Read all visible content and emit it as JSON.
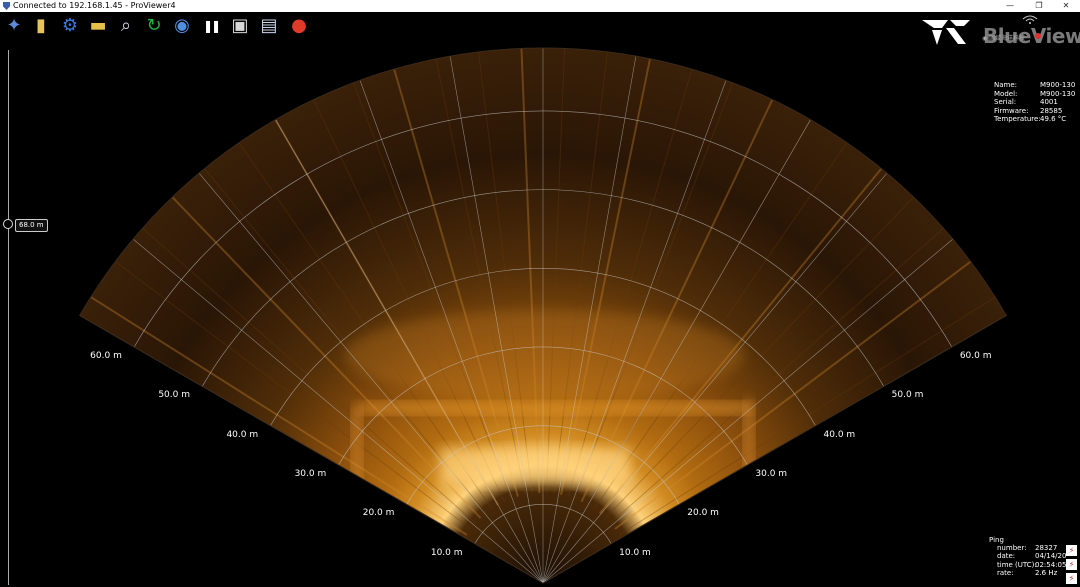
{
  "window": {
    "title": "Connected to 192.168.1.45 - ProViewer4",
    "minimize_glyph": "—",
    "restore_glyph": "❐",
    "close_glyph": "✕"
  },
  "toolbar": {
    "items": [
      {
        "name": "satellite-icon",
        "glyph": "✦",
        "color": "#5b8ad6"
      },
      {
        "name": "folder-icon",
        "glyph": "▮",
        "color": "#e8c25a"
      },
      {
        "name": "gears-icon",
        "glyph": "⚙",
        "color": "#3c78d8"
      },
      {
        "name": "ruler-icon",
        "glyph": "▬",
        "color": "#e6c04a"
      },
      {
        "name": "magnifier-icon",
        "glyph": "⌕",
        "color": "#d0d8e8"
      },
      {
        "name": "refresh-icon",
        "glyph": "↻",
        "color": "#22b03c"
      },
      {
        "name": "broadcast-icon",
        "glyph": "◉",
        "color": "#4f8fe0"
      },
      {
        "name": "pause-icon",
        "glyph": "❚❚",
        "color": "#ffffff"
      },
      {
        "name": "camera-icon",
        "glyph": "▣",
        "color": "#d8d8d8"
      },
      {
        "name": "video-camera-icon",
        "glyph": "▤",
        "color": "#c8d4e8"
      },
      {
        "name": "record-icon",
        "glyph": "●",
        "color": "#e03a2a"
      }
    ]
  },
  "logo": {
    "brand": "BlueView",
    "subtext": "◉ 国域海洋科技"
  },
  "device_info": [
    {
      "label": "Name:",
      "value": "M900-130"
    },
    {
      "label": "Model:",
      "value": "M900-130"
    },
    {
      "label": "Serial:",
      "value": "4001"
    },
    {
      "label": "Firmware:",
      "value": "28585"
    },
    {
      "label": "Temperature:",
      "value": "49.6 °C"
    }
  ],
  "range_slider": {
    "value_label": "68.0 m",
    "level_fraction": 0.68
  },
  "range_labels": [
    "10.0 m",
    "20.0 m",
    "30.0 m",
    "40.0 m",
    "50.0 m",
    "60.0 m"
  ],
  "ping": {
    "heading": "Ping",
    "rows": [
      {
        "label": "number:",
        "value": "28327"
      },
      {
        "label": "date:",
        "value": "04/14/20"
      },
      {
        "label": "time (UTC):",
        "value": "02:54:05"
      },
      {
        "label": "rate:",
        "value": "2.6 Hz"
      }
    ]
  },
  "colors": {
    "sonar_bright": "#ffd27a",
    "sonar_mid": "#b06a10",
    "sonar_dark": "#2a1606",
    "grid": "#c8c8c8"
  }
}
